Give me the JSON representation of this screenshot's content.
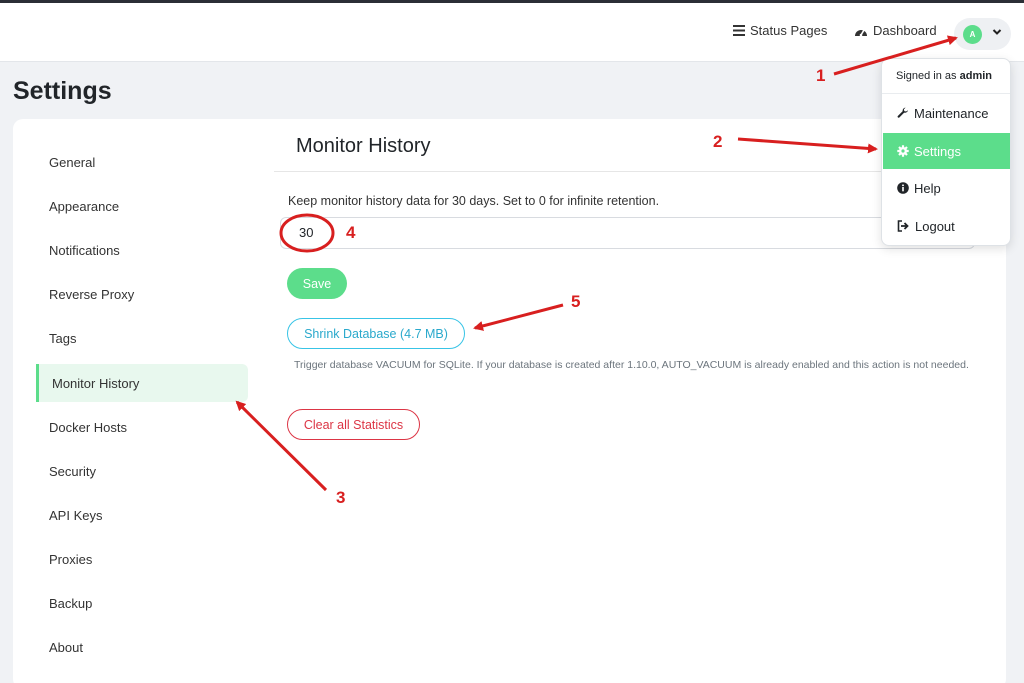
{
  "header": {
    "status_pages_label": "Status Pages",
    "dashboard_label": "Dashboard",
    "avatar_initial": "A"
  },
  "page_title": "Settings",
  "sidebar": {
    "items": [
      {
        "label": "General"
      },
      {
        "label": "Appearance"
      },
      {
        "label": "Notifications"
      },
      {
        "label": "Reverse Proxy"
      },
      {
        "label": "Tags"
      },
      {
        "label": "Monitor History",
        "active": true
      },
      {
        "label": "Docker Hosts"
      },
      {
        "label": "Security"
      },
      {
        "label": "API Keys"
      },
      {
        "label": "Proxies"
      },
      {
        "label": "Backup"
      },
      {
        "label": "About"
      }
    ]
  },
  "main": {
    "section_title": "Monitor History",
    "retention_hint": "Keep monitor history data for 30 days. Set to 0 for infinite retention.",
    "retention_value": "30",
    "save_label": "Save",
    "shrink_label": "Shrink Database (4.7 MB)",
    "vacuum_help": "Trigger database VACUUM for SQLite. If your database is created after 1.10.0, AUTO_VACUUM is already enabled and this action is not needed.",
    "clear_label": "Clear all Statistics"
  },
  "dropdown": {
    "signed_in_prefix": "Signed in as",
    "username": "admin",
    "items": [
      {
        "label": "Maintenance",
        "icon": "wrench-icon"
      },
      {
        "label": "Settings",
        "icon": "gear-icon",
        "active": true
      },
      {
        "label": "Help",
        "icon": "info-icon"
      },
      {
        "label": "Logout",
        "icon": "logout-icon"
      }
    ]
  },
  "annotations": {
    "labels": [
      "1",
      "2",
      "3",
      "4",
      "5"
    ]
  },
  "colors": {
    "accent": "#5cdd8b",
    "danger": "#dc3545",
    "info": "#38c4e6",
    "annotation": "#d81f1f"
  }
}
